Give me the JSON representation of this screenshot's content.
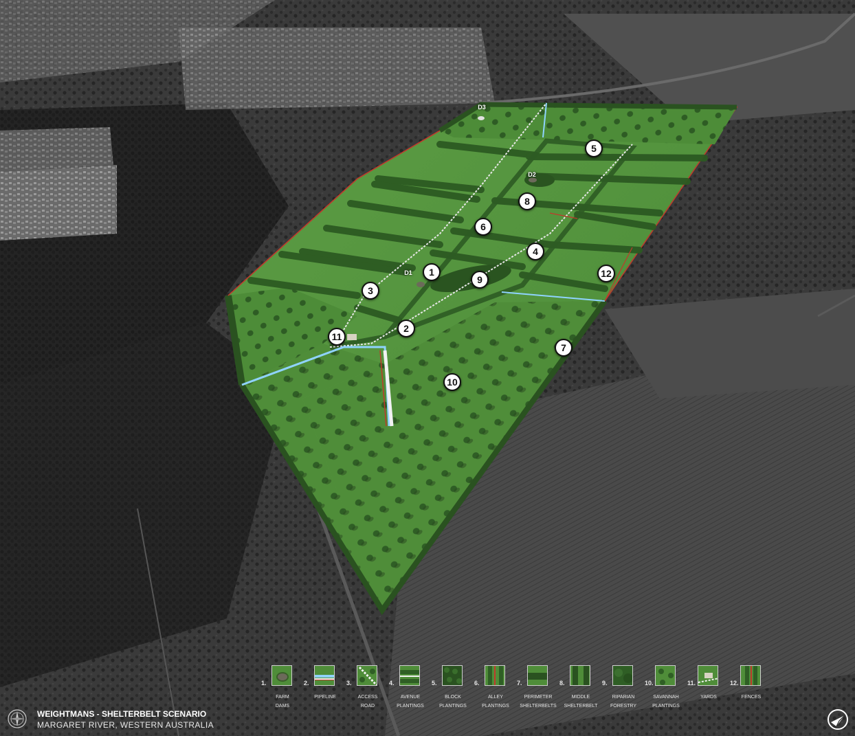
{
  "title": {
    "main": "WEIGHTMANS - SHELTERBELT SCENARIO",
    "subtitle": "MARGARET RIVER, WESTERN AUSTRALIA"
  },
  "map": {
    "markers": [
      "1",
      "2",
      "3",
      "4",
      "5",
      "6",
      "7",
      "8",
      "9",
      "10",
      "11",
      "12"
    ],
    "dams": [
      "D1",
      "D2",
      "D3"
    ]
  },
  "legend": [
    {
      "num": "1.",
      "label": "FARM\nDAMS",
      "swatch": "farm-dams"
    },
    {
      "num": "2.",
      "label": "PIPELINE",
      "swatch": "pipeline"
    },
    {
      "num": "3.",
      "label": "ACCESS\nROAD",
      "swatch": "access-road"
    },
    {
      "num": "4.",
      "label": "AVENUE\nPLANTINGS",
      "swatch": "avenue-plantings"
    },
    {
      "num": "5.",
      "label": "BLOCK\nPLANTINGS",
      "swatch": "block-plantings"
    },
    {
      "num": "6.",
      "label": "ALLEY\nPLANTINGS",
      "swatch": "alley-plantings"
    },
    {
      "num": "7.",
      "label": "PERIMETER\nSHELTERBELTS",
      "swatch": "perimeter-shelterbelts"
    },
    {
      "num": "8.",
      "label": "MIDDLE\nSHELTERBELT",
      "swatch": "middle-shelterbelt"
    },
    {
      "num": "9.",
      "label": "RIPARIAN\nFORESTRY",
      "swatch": "riparian-forestry"
    },
    {
      "num": "10.",
      "label": "SAVANNAH\nPLANTINGS",
      "swatch": "savannah-plantings"
    },
    {
      "num": "11.",
      "label": "YARDS",
      "swatch": "yards"
    },
    {
      "num": "12.",
      "label": "FENCES",
      "swatch": "fences"
    }
  ],
  "colors": {
    "field_green": "#4e8f3a",
    "tree_green": "#2f5e25",
    "fence_red": "#c0392b",
    "pipeline_blue": "#8fd3ff",
    "road_white": "#f2f2f2"
  }
}
